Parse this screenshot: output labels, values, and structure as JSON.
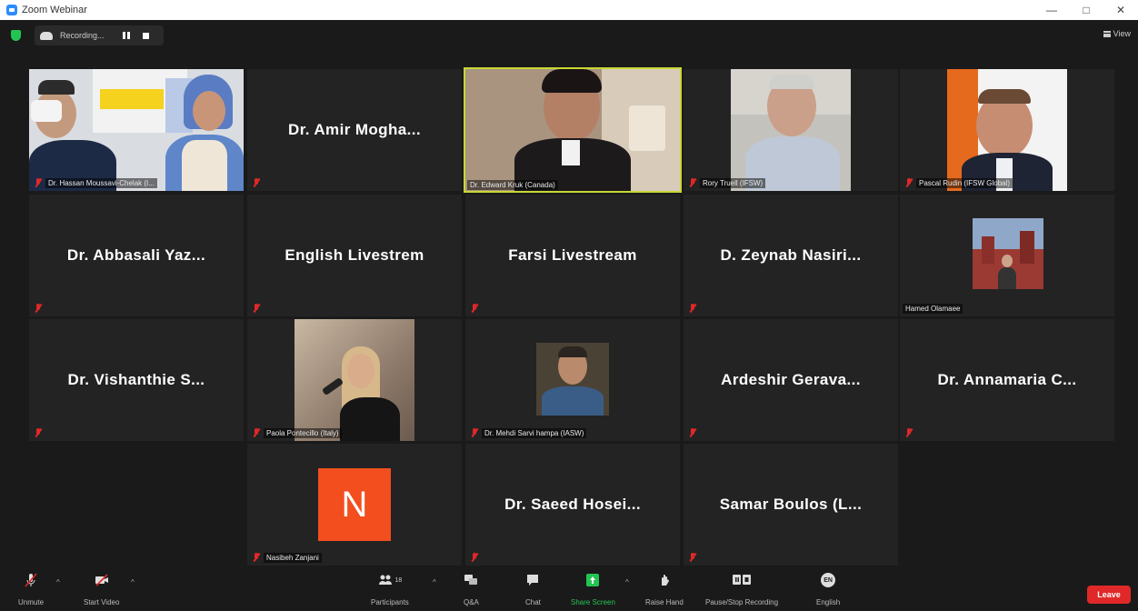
{
  "window": {
    "title": "Zoom Webinar",
    "controls": [
      "—",
      "□",
      "✕"
    ]
  },
  "topbar": {
    "recording_label": "Recording...",
    "view_label": "View"
  },
  "participants": [
    {
      "name": "Dr. Hassan Moussavi-Chelak (I...",
      "display": "video"
    },
    {
      "name": "",
      "display": "Dr. Amir Mogha..."
    },
    {
      "name": "Dr. Edward Kruk (Canada)",
      "display": "video"
    },
    {
      "name": "Rory Truell (IFSW)",
      "display": "video"
    },
    {
      "name": "Pascal Rudin (IFSW Global)",
      "display": "video"
    },
    {
      "name": "",
      "display": "Dr. Abbasali Yaz..."
    },
    {
      "name": "",
      "display": "English Livestrem"
    },
    {
      "name": "",
      "display": "Farsi Livestream"
    },
    {
      "name": "",
      "display": "D. Zeynab Nasiri..."
    },
    {
      "name": "Hamed Olamaee",
      "display": "video"
    },
    {
      "name": "",
      "display": "Dr. Vishanthie S..."
    },
    {
      "name": "Paola Pontecillo (Italy)",
      "display": "video"
    },
    {
      "name": "Dr. Mehdi Sarvi hampa (IASW)",
      "display": "video"
    },
    {
      "name": "",
      "display": "Ardeshir Gerava..."
    },
    {
      "name": "",
      "display": "Dr. Annamaria C..."
    },
    {
      "name": "Nasibeh Zanjani",
      "display": "avatar",
      "avatar_letter": "N"
    },
    {
      "name": "",
      "display": "Dr. Saeed Hosei..."
    },
    {
      "name": "",
      "display": "Samar Boulos (L..."
    }
  ],
  "toolbar": {
    "unmute": "Unmute",
    "start_video": "Start Video",
    "participants": "Participants",
    "participants_count": "18",
    "qa": "Q&A",
    "chat": "Chat",
    "share_screen": "Share Screen",
    "raise_hand": "Raise Hand",
    "pause_stop": "Pause/Stop Recording",
    "language": "English",
    "language_badge": "EN",
    "leave": "Leave"
  },
  "colors": {
    "accent_green": "#23c552",
    "leave_red": "#e02828",
    "active_outline": "#c8d834",
    "avatar_orange": "#f24e1e"
  }
}
